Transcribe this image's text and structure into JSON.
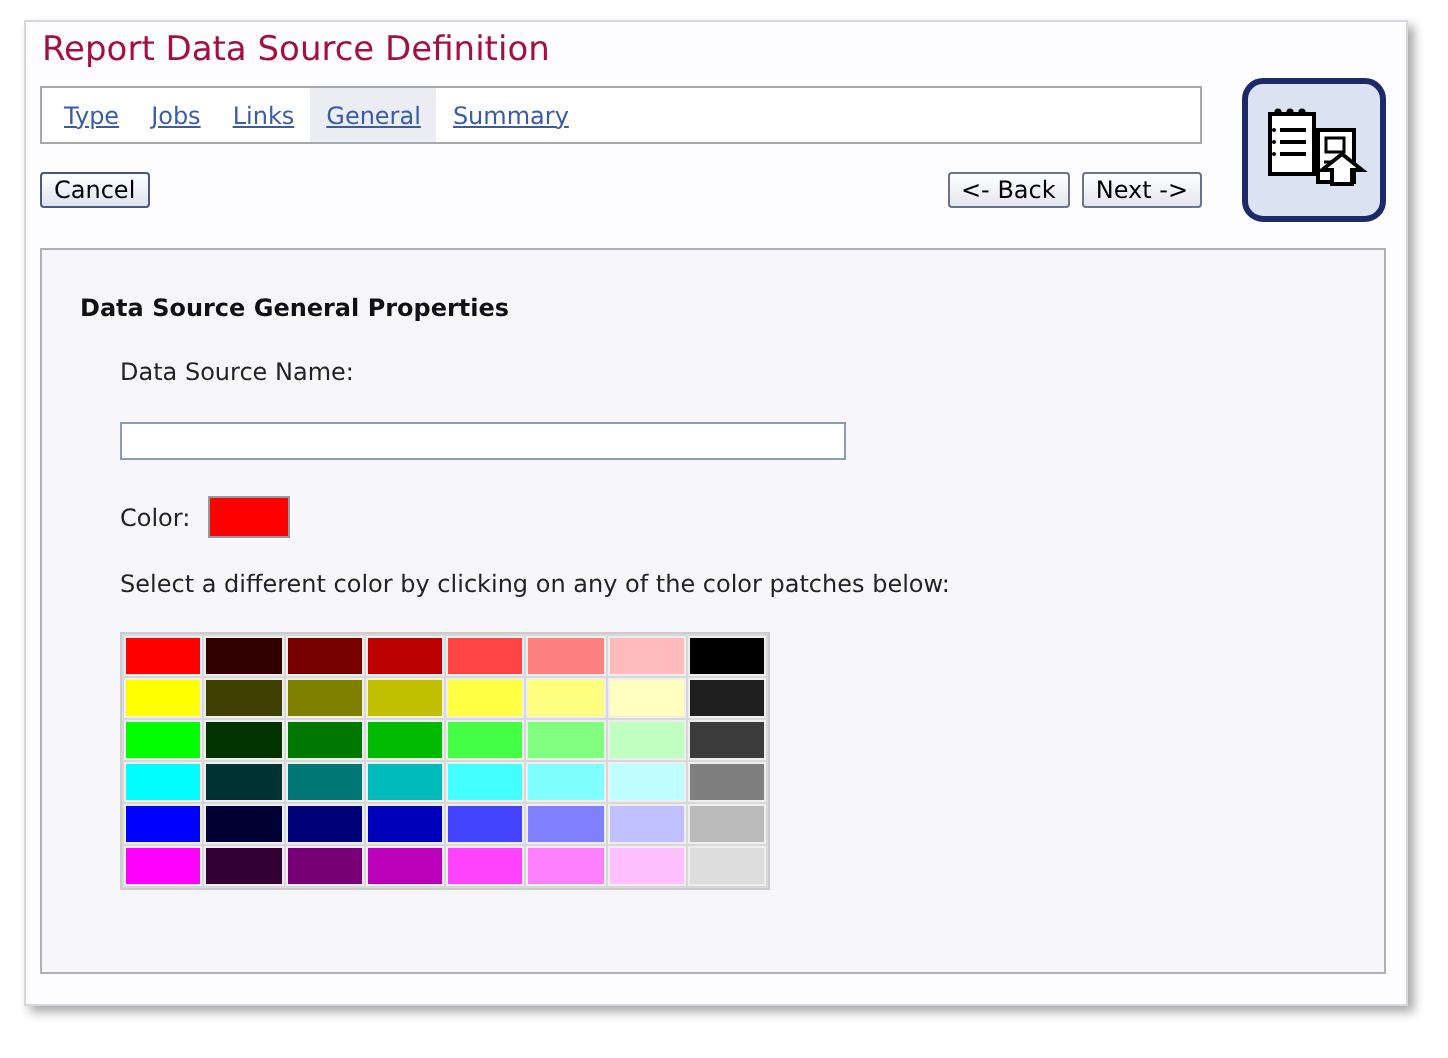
{
  "title": "Report Data Source Definition",
  "tabs": [
    {
      "label": "Type",
      "selected": false
    },
    {
      "label": "Jobs",
      "selected": false
    },
    {
      "label": "Links",
      "selected": false
    },
    {
      "label": "General",
      "selected": true
    },
    {
      "label": "Summary",
      "selected": false
    }
  ],
  "buttons": {
    "cancel": "Cancel",
    "back": "<- Back",
    "next": "Next ->"
  },
  "section_title": "Data Source General Properties",
  "name_field": {
    "label": "Data Source Name:"
  },
  "color_field": {
    "label": "Color:",
    "color": "#ff0000"
  },
  "palette_hint": "Select a different color by clicking on any of the color patches below:",
  "palette": [
    {
      "patches": [
        {
          "color": "#ff0000"
        },
        {
          "color": "#330000"
        },
        {
          "color": "#770000"
        },
        {
          "color": "#bb0000"
        },
        {
          "color": "#ff4444"
        },
        {
          "color": "#ff8080"
        },
        {
          "color": "#ffbbbb"
        },
        {
          "color": "#000000"
        }
      ]
    },
    {
      "patches": [
        {
          "color": "#ffff00"
        },
        {
          "color": "#3f3f00"
        },
        {
          "color": "#808000"
        },
        {
          "color": "#c0c000"
        },
        {
          "color": "#ffff44"
        },
        {
          "color": "#ffff80"
        },
        {
          "color": "#ffffc0"
        },
        {
          "color": "#1e1e1e"
        }
      ]
    },
    {
      "patches": [
        {
          "color": "#00ff00"
        },
        {
          "color": "#003300"
        },
        {
          "color": "#007700"
        },
        {
          "color": "#00bb00"
        },
        {
          "color": "#44ff44"
        },
        {
          "color": "#80ff80"
        },
        {
          "color": "#c0ffc0"
        },
        {
          "color": "#3c3c3c"
        }
      ]
    },
    {
      "patches": [
        {
          "color": "#00ffff"
        },
        {
          "color": "#003333"
        },
        {
          "color": "#007777"
        },
        {
          "color": "#00bbbb"
        },
        {
          "color": "#44ffff"
        },
        {
          "color": "#80ffff"
        },
        {
          "color": "#c0ffff"
        },
        {
          "color": "#7f7f7f"
        }
      ]
    },
    {
      "patches": [
        {
          "color": "#0000ff"
        },
        {
          "color": "#000033"
        },
        {
          "color": "#000077"
        },
        {
          "color": "#0000bb"
        },
        {
          "color": "#4444ff"
        },
        {
          "color": "#8080ff"
        },
        {
          "color": "#c0c0ff"
        },
        {
          "color": "#bbbbbb"
        }
      ]
    },
    {
      "patches": [
        {
          "color": "#ff00ff"
        },
        {
          "color": "#330033"
        },
        {
          "color": "#770077"
        },
        {
          "color": "#bb00bb"
        },
        {
          "color": "#ff44ff"
        },
        {
          "color": "#ff80ff"
        },
        {
          "color": "#ffc0ff"
        },
        {
          "color": "#dddddd"
        }
      ]
    }
  ]
}
